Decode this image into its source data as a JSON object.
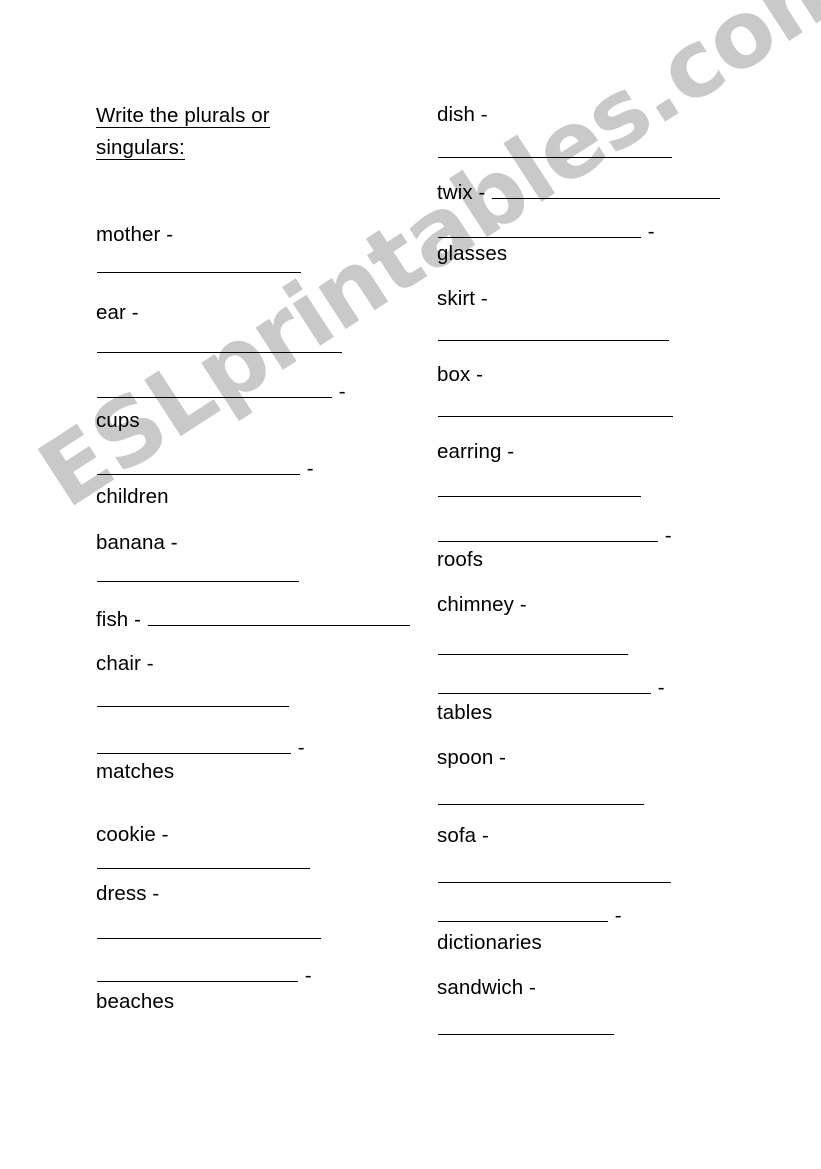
{
  "page": {
    "background": "#ffffff",
    "text_color": "#000000",
    "rule_color": "#000000"
  },
  "watermark": {
    "text": "ESLprintables.com",
    "color": "#c9c9c9",
    "rotation_deg": -33
  },
  "title": {
    "line1": "Write the plurals or",
    "line2": "singulars:"
  },
  "dash": "-",
  "left_column": [
    {
      "word": "mother",
      "order": "word-first"
    },
    {
      "word": "ear",
      "order": "word-first"
    },
    {
      "word": "cups",
      "order": "blank-first"
    },
    {
      "word": "children",
      "order": "blank-first"
    },
    {
      "word": "banana",
      "order": "word-first"
    },
    {
      "word": "fish",
      "order": "word-first-inline"
    },
    {
      "word": "chair",
      "order": "word-first"
    },
    {
      "word": "matches",
      "order": "blank-first"
    },
    {
      "word": "cookie",
      "order": "word-first"
    },
    {
      "word": "dress",
      "order": "word-first"
    },
    {
      "word": "beaches",
      "order": "blank-first"
    }
  ],
  "right_column": [
    {
      "word": "dish",
      "order": "word-first"
    },
    {
      "word": "twix",
      "order": "word-first-inline"
    },
    {
      "word": "glasses",
      "order": "blank-first"
    },
    {
      "word": "skirt",
      "order": "word-first"
    },
    {
      "word": "box",
      "order": "word-first"
    },
    {
      "word": "earring",
      "order": "word-first"
    },
    {
      "word": "roofs",
      "order": "blank-first"
    },
    {
      "word": "chimney",
      "order": "word-first"
    },
    {
      "word": "tables",
      "order": "blank-first"
    },
    {
      "word": "spoon",
      "order": "word-first"
    },
    {
      "word": "sofa",
      "order": "word-first"
    },
    {
      "word": "dictionaries",
      "order": "blank-first"
    },
    {
      "word": "sandwich",
      "order": "word-first"
    }
  ]
}
